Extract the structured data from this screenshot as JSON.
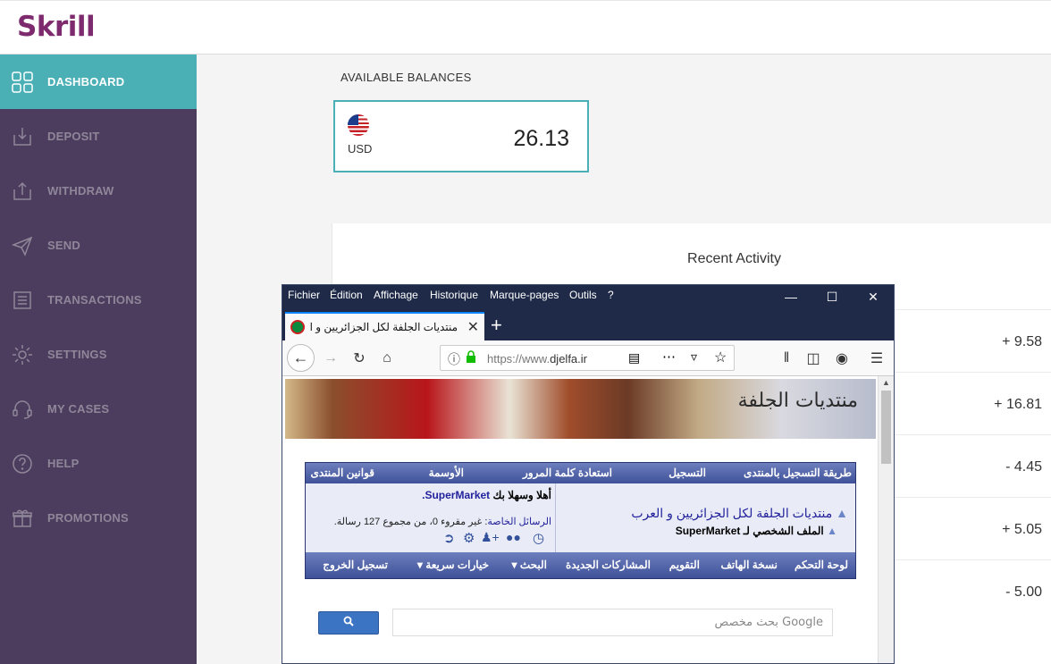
{
  "app": {
    "logo": "Skrill"
  },
  "sidebar": {
    "items": [
      {
        "label": "DASHBOARD",
        "icon": "dashboard-icon",
        "active": true
      },
      {
        "label": "DEPOSIT",
        "icon": "deposit-icon"
      },
      {
        "label": "WITHDRAW",
        "icon": "withdraw-icon"
      },
      {
        "label": "SEND",
        "icon": "send-icon"
      },
      {
        "label": "TRANSACTIONS",
        "icon": "transactions-icon"
      },
      {
        "label": "SETTINGS",
        "icon": "settings-icon"
      },
      {
        "label": "MY CASES",
        "icon": "headset-icon"
      },
      {
        "label": "HELP",
        "icon": "help-icon"
      },
      {
        "label": "PROMOTIONS",
        "icon": "gift-icon"
      }
    ]
  },
  "balances": {
    "heading": "AVAILABLE BALANCES",
    "currency": "USD",
    "amount": "26.13"
  },
  "activity": {
    "title": "Recent Activity",
    "amounts": [
      "+ 9.58",
      "+ 16.81",
      "- 4.45",
      "+ 5.05",
      "- 5.00"
    ]
  },
  "browser": {
    "menu": [
      "Fichier",
      "Édition",
      "Affichage",
      "Historique",
      "Marque-pages",
      "Outils",
      "?"
    ],
    "tab_title": "منتديات الجلفة لكل الجزائريين و الع",
    "url_prefix": "https://www.",
    "url_domain": "djelfa.ir"
  },
  "forum": {
    "banner_logo": "منتديات الجلفة",
    "top_links": [
      "طريقة التسجيل بالمنتدى",
      "التسجيل",
      "استعادة كلمة المرور",
      "الأوسمة",
      "قوانين المنتدى"
    ],
    "site_title": "منتديات الجلفة لكل الجزائريين و العرب",
    "profile_link": "الملف الشخصي لـ SuperMarket",
    "welcome": "أهلا وسهلا بك",
    "username": "SuperMarket.",
    "pm_label": "الرسائل الخاصة",
    "pm_status": ": غير مقروء 0، من مجموع 127 رسالة.",
    "bottom_links": [
      "لوحة التحكم",
      "نسخة الهاتف",
      "التقويم",
      "المشاركات الجديدة",
      "البحث",
      "خيارات سريعة",
      "تسجيل الخروج"
    ],
    "search_placeholder": "Google بحث مخصص"
  }
}
